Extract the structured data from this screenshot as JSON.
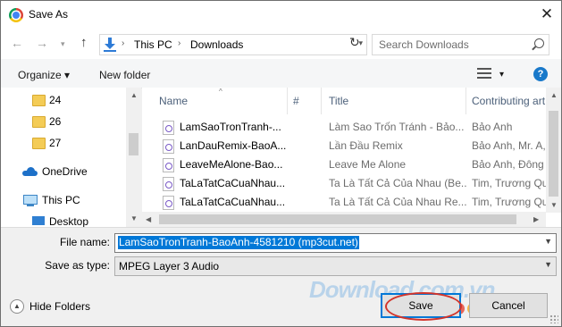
{
  "window": {
    "title": "Save As",
    "close_glyph": "✕"
  },
  "address_bar": {
    "back_glyph": "←",
    "forward_glyph": "→",
    "up_glyph": "↑",
    "breadcrumb": [
      "This PC",
      "Downloads"
    ],
    "separator_glyph": "›",
    "dropdown_glyph": "▾",
    "refresh_glyph": "↻",
    "search_placeholder": "Search Downloads"
  },
  "toolbar": {
    "organize_label": "Organize ▾",
    "new_folder_label": "New folder",
    "view_dropdown_glyph": "▾",
    "help_glyph": "?"
  },
  "nav_pane": {
    "items": [
      {
        "label": "24",
        "icon": "folder-icon"
      },
      {
        "label": "26",
        "icon": "folder-icon"
      },
      {
        "label": "27",
        "icon": "folder-icon"
      },
      {
        "label": "OneDrive",
        "icon": "cloud-icon"
      },
      {
        "label": "This PC",
        "icon": "computer-icon"
      },
      {
        "label": "Desktop",
        "icon": "desktop-icon"
      }
    ]
  },
  "file_list": {
    "columns": [
      "Name",
      "#",
      "Title",
      "Contributing art"
    ],
    "rows": [
      {
        "name": "LamSaoTronTranh-...",
        "title": "Làm Sao Trốn Tránh - Bảo...",
        "artist": "Bảo Anh"
      },
      {
        "name": "LanDauRemix-BaoA...",
        "title": "Lần Đầu Remix",
        "artist": "Bảo Anh, Mr. A,"
      },
      {
        "name": "LeaveMeAlone-Bao...",
        "title": "Leave Me Alone",
        "artist": "Bảo Anh, Đông"
      },
      {
        "name": "TaLaTatCaCuaNhau...",
        "title": "Ta Là Tất Cả Của Nhau (Be...",
        "artist": "Tim, Trương Qu"
      },
      {
        "name": "TaLaTatCaCuaNhau...",
        "title": "Ta Là Tất Cả Của Nhau Re...",
        "artist": "Tim, Trương Qu"
      }
    ]
  },
  "form": {
    "file_name_label": "File name:",
    "file_name_value": "LamSaoTronTranh-BaoAnh-4581210 (mp3cut.net)",
    "save_as_type_label": "Save as type:",
    "save_as_type_value": "MPEG Layer 3 Audio"
  },
  "footer": {
    "hide_folders_label": "Hide Folders",
    "save_label": "Save",
    "cancel_label": "Cancel"
  },
  "watermark": {
    "text": "Download.com.vn",
    "dot_colors": [
      "#e84c3d",
      "#f5a623",
      "#3bb54a",
      "#2a9be0"
    ]
  },
  "colors": {
    "accent": "#0078d7",
    "highlight_circle": "#d2342b"
  }
}
